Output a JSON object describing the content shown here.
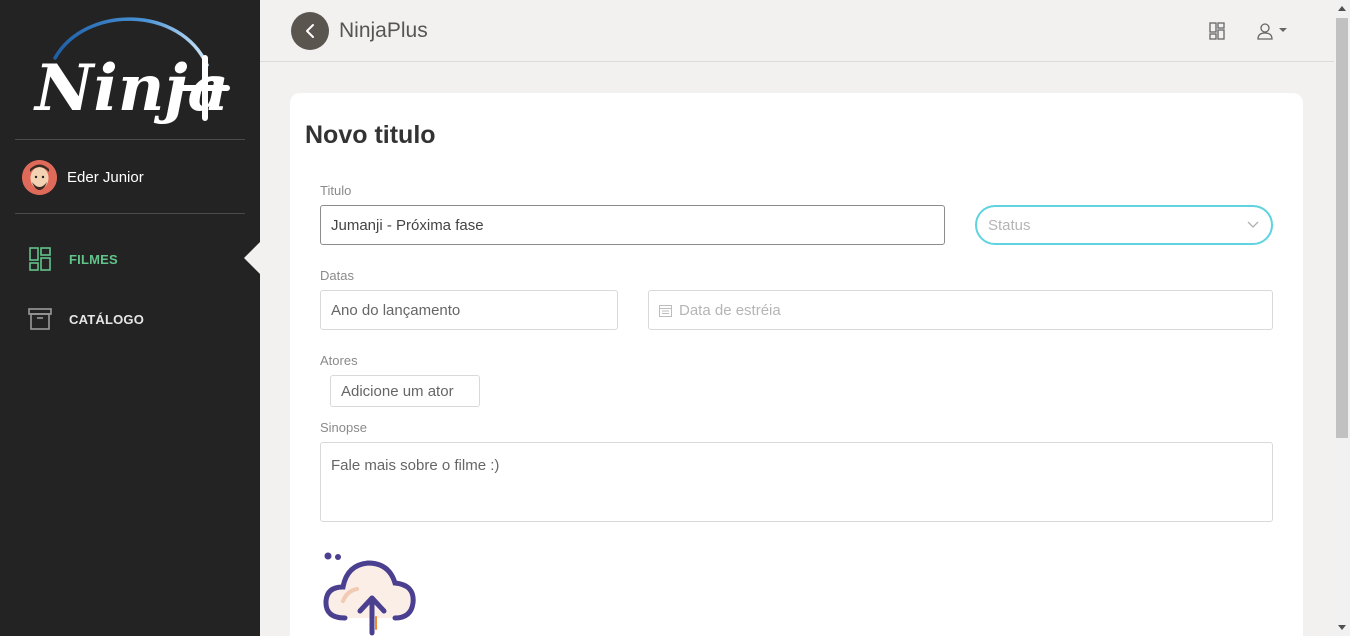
{
  "app": {
    "title": "NinjaPlus"
  },
  "sidebar": {
    "logo_text": "Ninja+",
    "user": {
      "name": "Eder Junior"
    },
    "items": [
      {
        "label": "FILMES",
        "icon": "dashboard-grid-icon",
        "active": true
      },
      {
        "label": "CATÁLOGO",
        "icon": "archive-box-icon",
        "active": false
      }
    ]
  },
  "topbar": {
    "icons": [
      "grid-view-icon",
      "user-menu-icon"
    ]
  },
  "form": {
    "title": "Novo titulo",
    "titulo": {
      "label": "Titulo",
      "value": "Jumanji - Próxima fase"
    },
    "status": {
      "placeholder": "Status"
    },
    "datas": {
      "label": "Datas",
      "ano_placeholder": "Ano do lançamento",
      "estreia_placeholder": "Data de estréia"
    },
    "atores": {
      "label": "Atores",
      "placeholder": "Adicione um ator"
    },
    "sinopse": {
      "label": "Sinopse",
      "placeholder": "Fale mais sobre o filme :)"
    },
    "upload_icon": "cloud-upload-icon"
  },
  "colors": {
    "sidebar_bg": "#232323",
    "accent_green": "#62c38a",
    "select_border": "#5fd3df",
    "upload_purple": "#4b3f8f"
  }
}
